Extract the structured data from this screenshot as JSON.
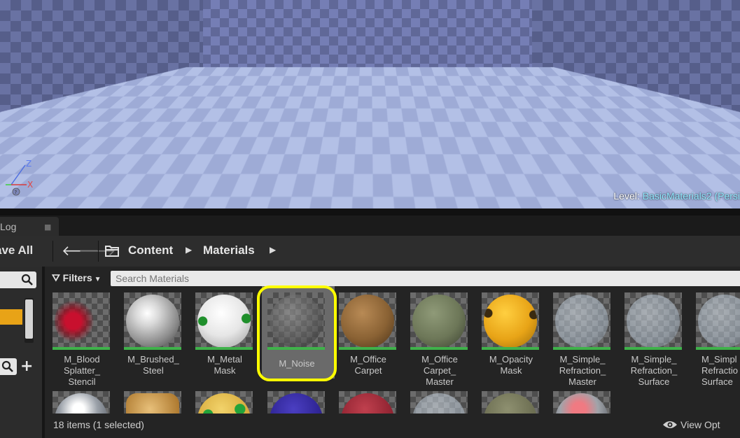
{
  "viewport": {
    "level_prefix": "Level:",
    "level_name": "BasicMaterials2 (Persi",
    "axis": {
      "z": "Z",
      "x": "X"
    }
  },
  "tabs": {
    "log_label": "Log"
  },
  "toolbar": {
    "save_all_label": "ave All",
    "breadcrumb": [
      "Content",
      "Materials"
    ]
  },
  "filters": {
    "label": "Filters"
  },
  "search": {
    "placeholder": "Search Materials"
  },
  "assets": [
    {
      "label": "M_Blood\nSplatter_\nStencil",
      "icon": "blood-sphere"
    },
    {
      "label": "M_Brushed_\nSteel",
      "icon": "steel-sphere"
    },
    {
      "label": "M_Metal\nMask",
      "icon": "white-green-sphere"
    },
    {
      "label": "M_Noise",
      "icon": "grey-noise-sphere",
      "selected": true
    },
    {
      "label": "M_Office\nCarpet",
      "icon": "brown-carpet-sphere"
    },
    {
      "label": "M_Office\nCarpet_\nMaster",
      "icon": "green-carpet-sphere"
    },
    {
      "label": "M_Opacity\nMask",
      "icon": "yellow-sphere"
    },
    {
      "label": "M_Simple_\nRefraction_\nMaster",
      "icon": "glass-sphere"
    },
    {
      "label": "M_Simple_\nRefraction_\nSurface",
      "icon": "glass-sphere"
    },
    {
      "label": "M_Simpl\nRefractio\nSurface",
      "icon": "glass-sphere"
    }
  ],
  "row2_icons": [
    "chrome-sphere",
    "gold-sphere",
    "yellow-green-sphere",
    "blue-sphere",
    "red-sphere",
    "glass-sphere",
    "olive-sphere",
    "chrome-pink-sphere"
  ],
  "status": {
    "count_text": "18 items (1 selected)",
    "view_options_label": "View Opt"
  },
  "colors": {
    "selection_highlight": "#ffff00",
    "level_name": "#8fe8ff",
    "asset_bar": "#3fb24a",
    "accent_swatch": "#e8a317"
  }
}
